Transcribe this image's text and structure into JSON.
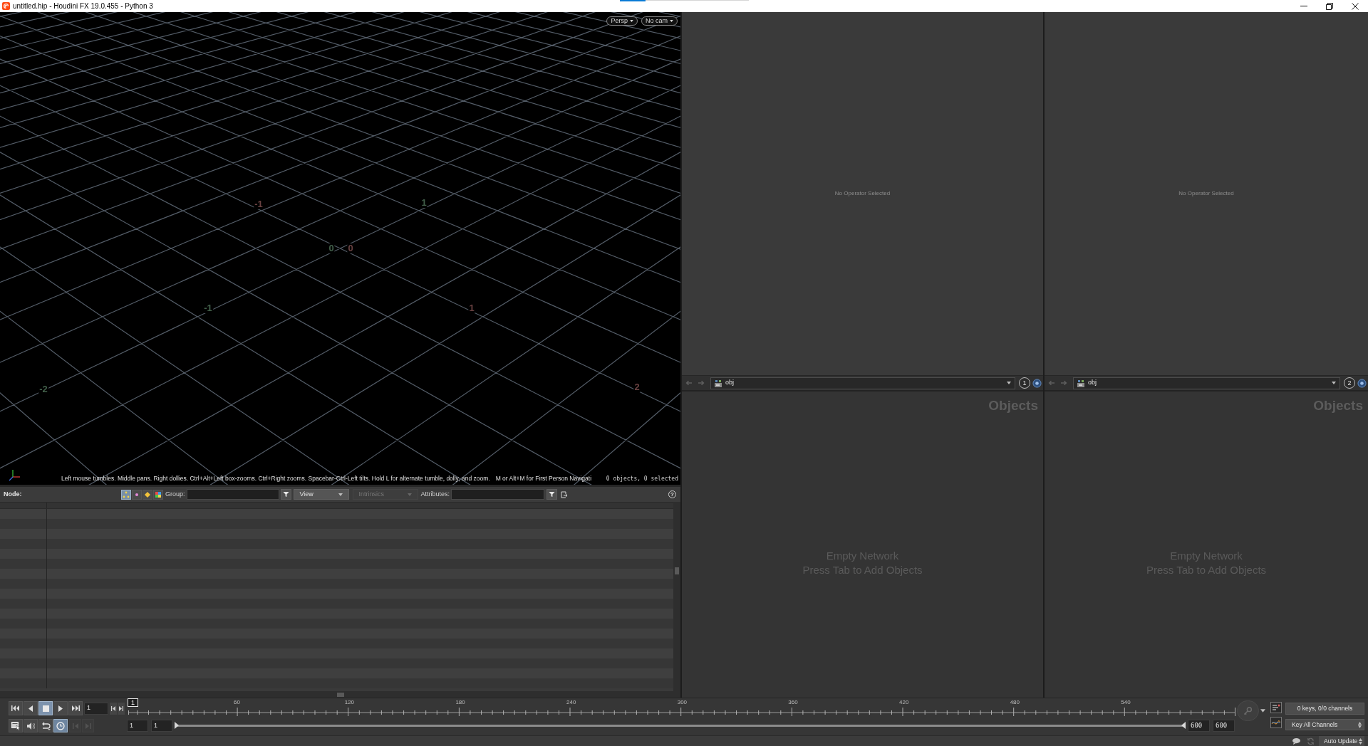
{
  "window": {
    "title": "untitled.hip - Houdini FX 19.0.455 - Python 3"
  },
  "viewport": {
    "camera_menus": [
      "Persp",
      "No cam"
    ],
    "grid_labels": [
      {
        "text": "-1",
        "color": "#6a4242"
      },
      {
        "text": "1",
        "color": "#42604a"
      },
      {
        "text": "0",
        "color": "#42604a"
      },
      {
        "text": "0",
        "color": "#6a4242"
      },
      {
        "text": "-1",
        "color": "#42604a"
      },
      {
        "text": "1",
        "color": "#6a4242"
      },
      {
        "text": "-2",
        "color": "#42604a"
      },
      {
        "text": "2",
        "color": "#6a4242"
      }
    ],
    "hint": "Left mouse tumbles. Middle pans. Right dollies. Ctrl+Alt+Left box-zooms. Ctrl+Right zooms. Spacebar-Ctrl-Left tilts. Hold L for alternate tumble, dolly, and zoom.",
    "hint_2": "M or Alt+M for First Person Navigati",
    "selection_status": "0 objects, 0 selected"
  },
  "spreadsheet": {
    "node_label": "Node:",
    "geometry_types": [
      {
        "kind": "points",
        "selected": true
      },
      {
        "kind": "vertices",
        "selected": false
      },
      {
        "kind": "primitives",
        "selected": false
      },
      {
        "kind": "detail",
        "selected": false
      }
    ],
    "group_label": "Group:",
    "view_menu": "View",
    "intrinsics_menu": {
      "label": "Intrinsics",
      "disabled": true
    },
    "attributes_label": "Attributes:",
    "help": "?"
  },
  "panes": [
    {
      "parameters_message": "No Operator Selected",
      "path": "obj",
      "pane_number": "1",
      "network_title": "Objects",
      "network_message": [
        "Empty Network",
        "Press Tab to Add Objects"
      ]
    },
    {
      "parameters_message": "No Operator Selected",
      "path": "obj",
      "pane_number": "2",
      "network_title": "Objects",
      "network_message": [
        "Empty Network",
        "Press Tab to Add Objects"
      ]
    }
  ],
  "playbar": {
    "transport": [
      {
        "kind": "first",
        "selected": false
      },
      {
        "kind": "reverse",
        "selected": false
      },
      {
        "kind": "stop",
        "selected": true
      },
      {
        "kind": "play",
        "selected": false
      },
      {
        "kind": "last",
        "selected": false
      }
    ],
    "frame": "1",
    "current_frame": "1",
    "ruler_labels": [
      "60",
      "120",
      "180",
      "240",
      "300",
      "360",
      "420",
      "480",
      "540"
    ],
    "tools": [
      {
        "kind": "options",
        "selected": false
      },
      {
        "kind": "audio",
        "selected": false
      },
      {
        "kind": "loop",
        "selected": false
      },
      {
        "kind": "realtime",
        "selected": true
      }
    ],
    "key_steps": [
      {
        "kind": "previous",
        "disabled": true
      },
      {
        "kind": "next",
        "disabled": true
      }
    ],
    "range_start": "1",
    "playback_start": "1",
    "playback_end": "600",
    "range_end": "600",
    "keys_status": "0 keys, 0/0 channels",
    "key_mode": "Key All Channels"
  },
  "status_bar": {
    "update_mode": "Auto Update"
  }
}
